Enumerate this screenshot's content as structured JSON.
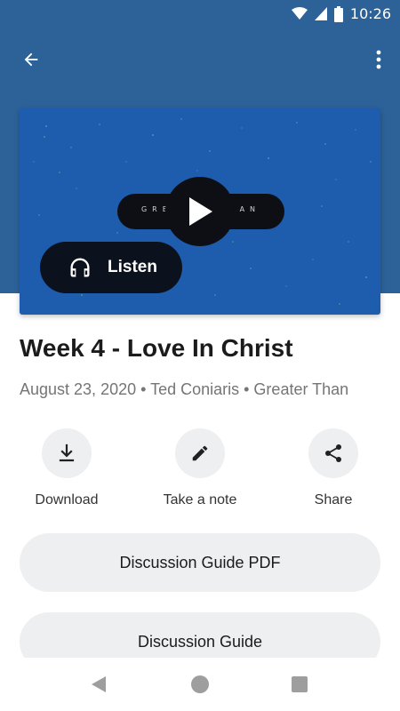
{
  "status_bar": {
    "time": "10:26"
  },
  "app_bar": {
    "back_icon": "arrow-back-icon",
    "more_icon": "more-vert-icon"
  },
  "video": {
    "overlay_text": "GREATER THAN",
    "play_icon": "play-icon",
    "background_color": "#1e5cae"
  },
  "listen": {
    "label": "Listen",
    "icon": "headphones-icon"
  },
  "episode": {
    "title": "Week 4 - Love In Christ",
    "meta": "August 23, 2020 • Ted Coniaris • Greater Than"
  },
  "actions": [
    {
      "label": "Download",
      "icon": "download-icon"
    },
    {
      "label": "Take a note",
      "icon": "pencil-icon"
    },
    {
      "label": "Share",
      "icon": "share-icon"
    }
  ],
  "buttons": {
    "discussion_pdf": "Discussion Guide PDF",
    "discussion_guide": "Discussion Guide"
  },
  "colors": {
    "header": "#2c6298",
    "accent_dark": "#0c121d"
  }
}
